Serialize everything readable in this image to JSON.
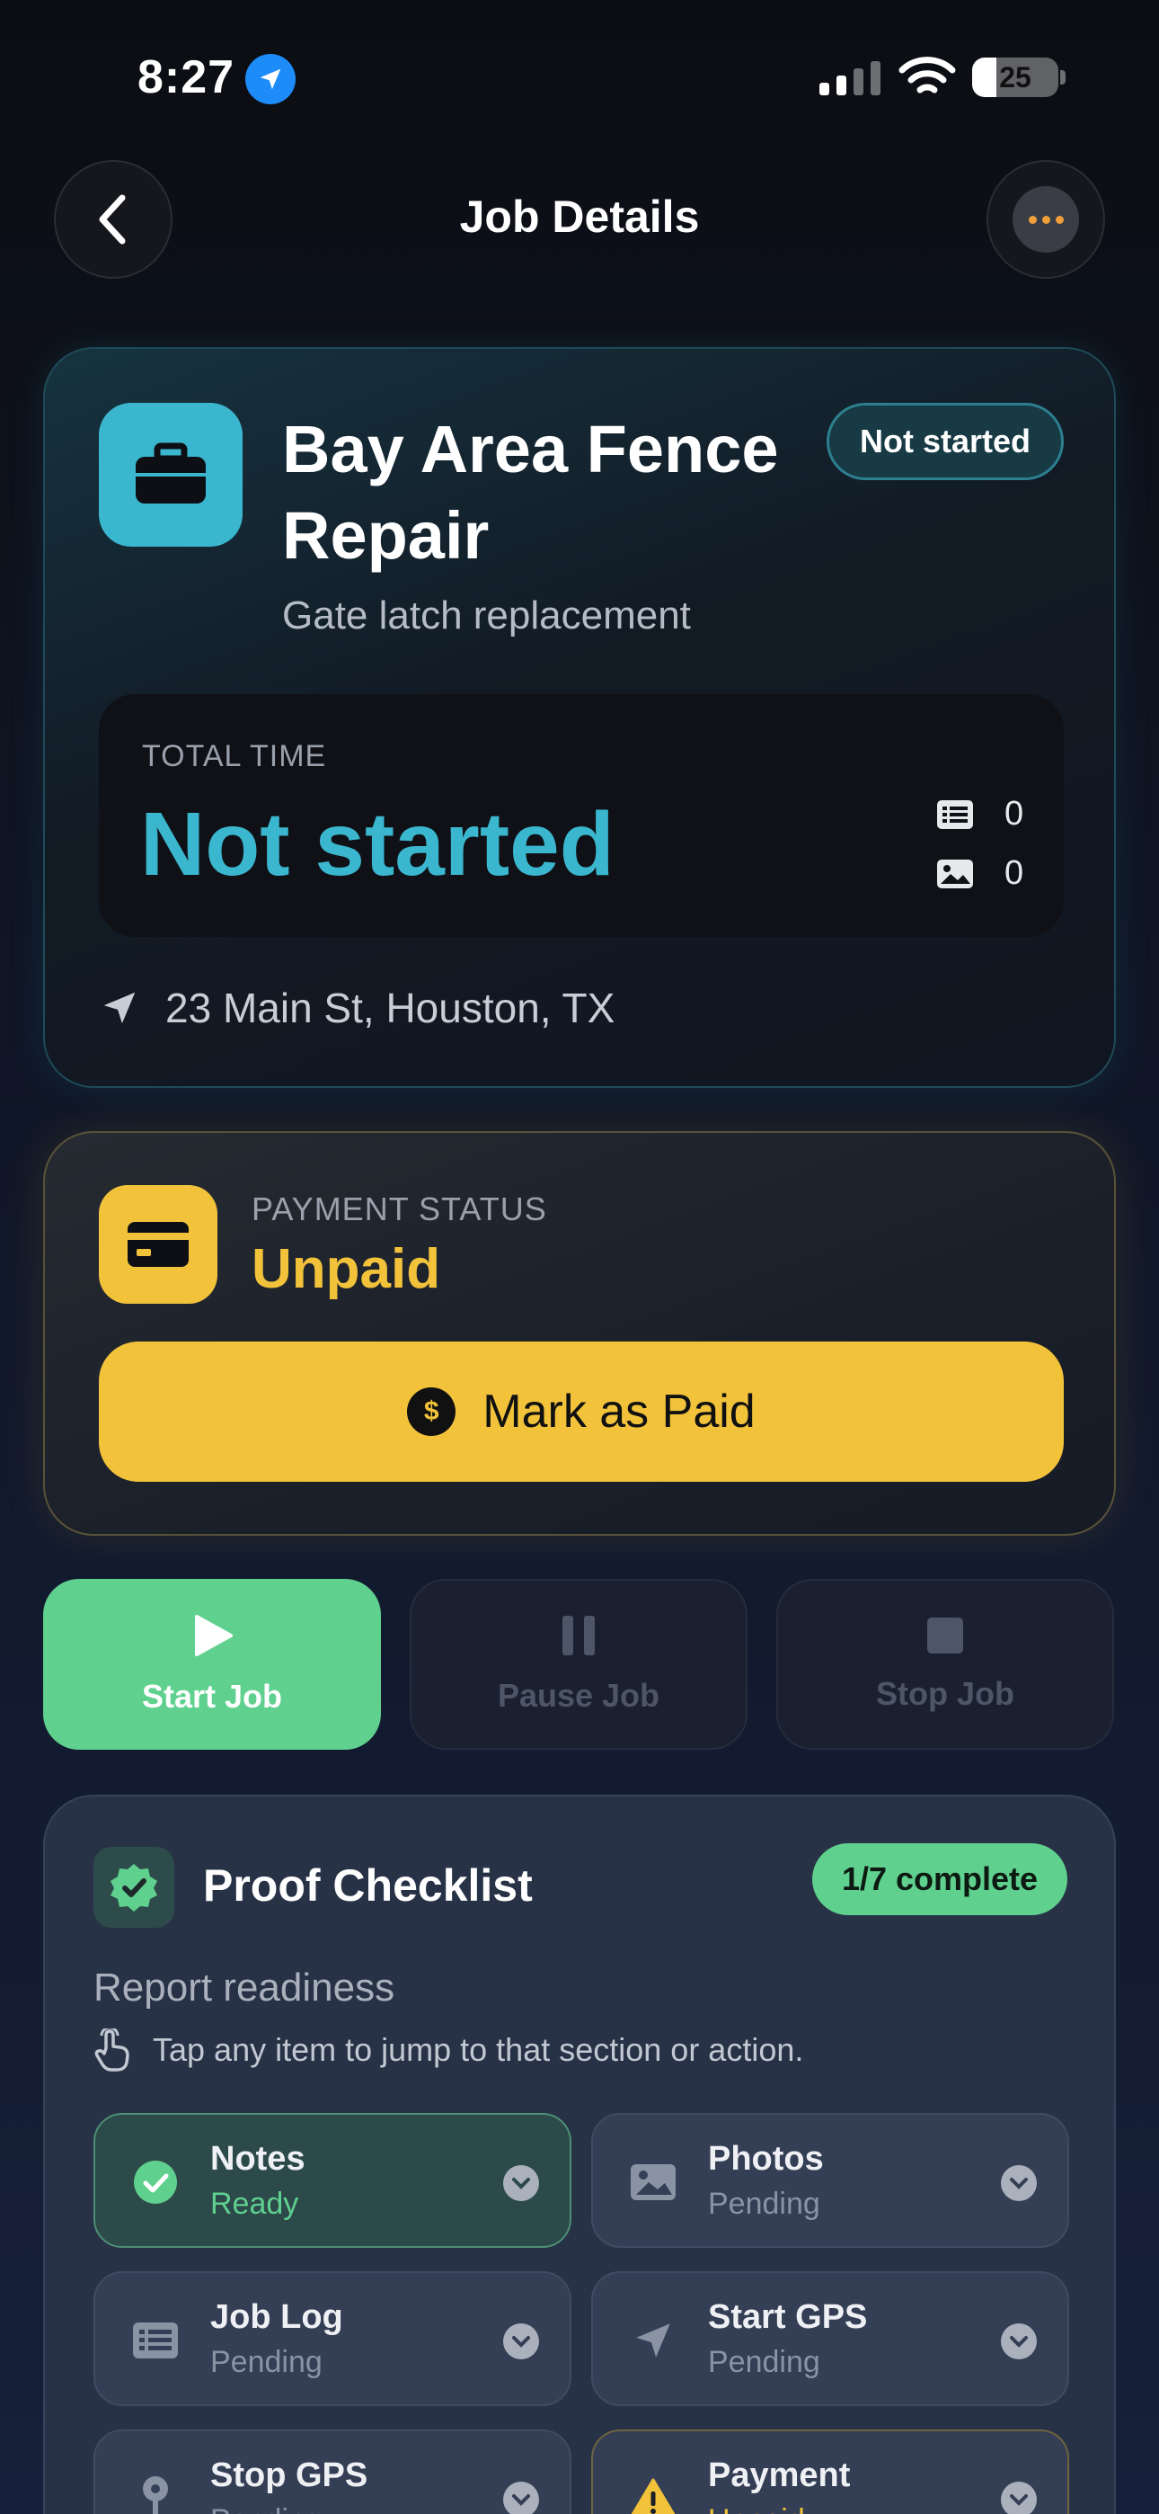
{
  "status_bar": {
    "time": "8:27",
    "battery": "25"
  },
  "header": {
    "title": "Job Details"
  },
  "job": {
    "title": "Bay Area Fence Repair",
    "subtitle": "Gate latch replacement",
    "status": "Not started",
    "total_time_label": "TOTAL TIME",
    "total_time_value": "Not started",
    "notes_count": "0",
    "photos_count": "0",
    "address": "23 Main St, Houston, TX",
    "accent_color": "#3bb6cf"
  },
  "payment": {
    "label": "PAYMENT STATUS",
    "value": "Unpaid",
    "button_label": "Mark as Paid",
    "dollar_symbol": "$",
    "accent_color": "#f2c33a"
  },
  "actions": {
    "start_label": "Start Job",
    "pause_label": "Pause Job",
    "stop_label": "Stop Job",
    "start_color": "#5fd08e"
  },
  "checklist": {
    "title": "Proof Checklist",
    "progress": "1/7 complete",
    "readiness_label": "Report readiness",
    "hint": "Tap any item to jump to that section or action.",
    "items": [
      {
        "name": "Notes",
        "status": "Ready",
        "icon": "check-circle-icon"
      },
      {
        "name": "Photos",
        "status": "Pending",
        "icon": "photo-icon"
      },
      {
        "name": "Job Log",
        "status": "Pending",
        "icon": "list-icon"
      },
      {
        "name": "Start GPS",
        "status": "Pending",
        "icon": "location-arrow-icon"
      },
      {
        "name": "Stop GPS",
        "status": "Pending",
        "icon": "map-pin-icon"
      },
      {
        "name": "Payment",
        "status": "Unpaid",
        "icon": "warning-icon"
      }
    ]
  }
}
